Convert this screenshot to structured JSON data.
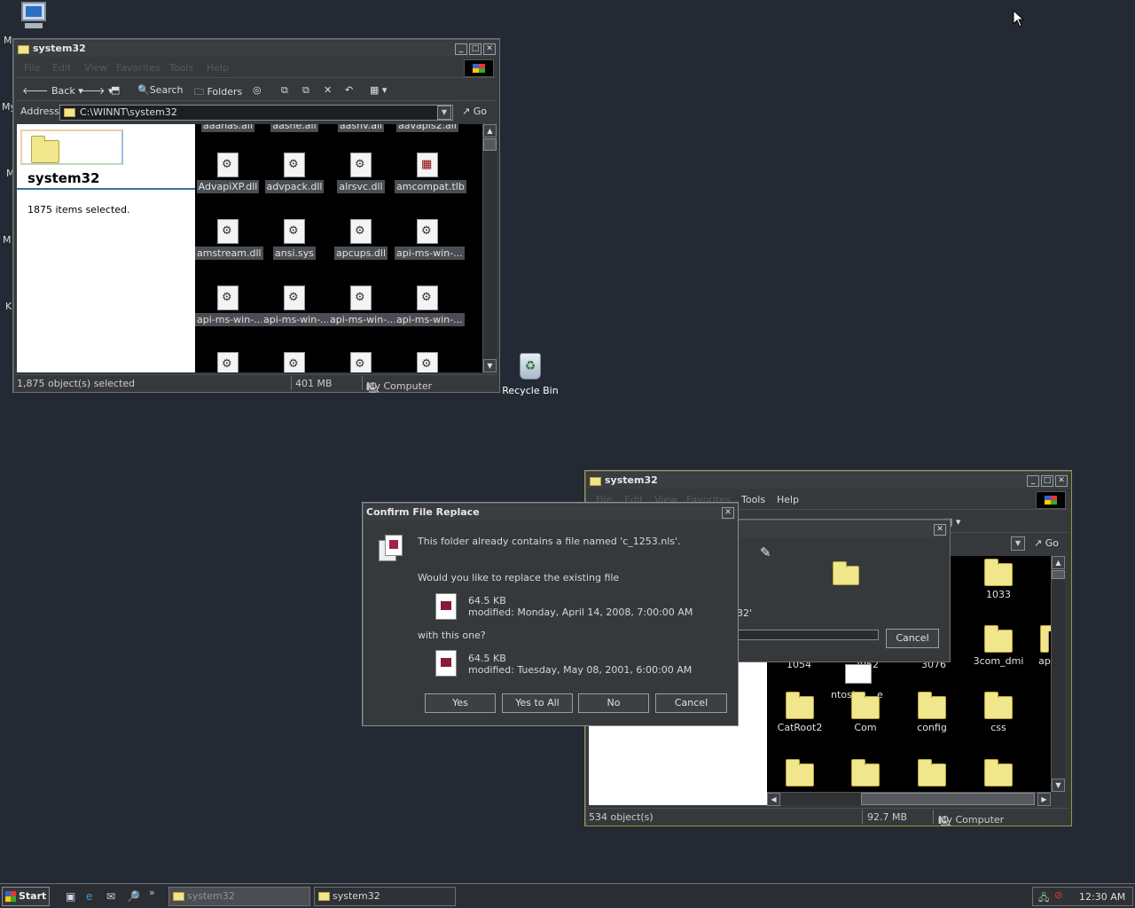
{
  "desktop": {
    "recycle_bin": "Recycle Bin",
    "left_letters": [
      "M",
      "My",
      "M",
      "M",
      "K"
    ]
  },
  "win1": {
    "title": "system32",
    "menu": [
      "File",
      "Edit",
      "View",
      "Favorites",
      "Tools",
      "Help"
    ],
    "toolbar": {
      "back": "Back",
      "search": "Search",
      "folders": "Folders"
    },
    "address_label": "Address",
    "address_value": "C:\\WINNT\\system32",
    "go": "Go",
    "pane_title": "system32",
    "pane_text": "1875 items selected.",
    "partial_row": [
      "aaanas.all",
      "aasne.all",
      "aasnv.all",
      "aavapis2.all"
    ],
    "files": [
      {
        "name": "AdvapiXP.dll",
        "icon": "dll-icon"
      },
      {
        "name": "advpack.dll",
        "icon": "dll-icon"
      },
      {
        "name": "alrsvc.dll",
        "icon": "dll-icon"
      },
      {
        "name": "amcompat.tlb",
        "icon": "tlb-icon"
      },
      {
        "name": "amstream.dll",
        "icon": "dll-icon"
      },
      {
        "name": "ansi.sys",
        "icon": "dll-icon"
      },
      {
        "name": "apcups.dll",
        "icon": "dll-icon"
      },
      {
        "name": "api-ms-win-...",
        "icon": "dll-icon"
      },
      {
        "name": "api-ms-win-...",
        "icon": "dll-icon"
      },
      {
        "name": "api-ms-win-...",
        "icon": "dll-icon"
      },
      {
        "name": "api-ms-win-...",
        "icon": "dll-icon"
      },
      {
        "name": "api-ms-win-...",
        "icon": "dll-icon"
      }
    ],
    "status": {
      "objects": "1,875 object(s) selected",
      "size": "401 MB",
      "zone": "My Computer"
    }
  },
  "win2": {
    "title": "system32",
    "menu": [
      "File",
      "Edit",
      "View",
      "Favorites",
      "Tools",
      "Help"
    ],
    "go": "Go",
    "folders_top": [
      "1033",
      "3com_dmi"
    ],
    "partial_labels": [
      "1054",
      "2052",
      "3076",
      "ap",
      "ntosk",
      "e"
    ],
    "folders": [
      "CatRoot2",
      "Com",
      "config",
      "css"
    ],
    "status": {
      "objects": "534 object(s)",
      "size": "92.7 MB",
      "zone": "My Computer"
    }
  },
  "copy_dialog": {
    "cancel": "Cancel",
    "partial_text": "32'"
  },
  "confirm": {
    "title": "Confirm File Replace",
    "line1": "This folder already contains a file named 'c_1253.nls'.",
    "line2": "Would you like to replace the existing file",
    "existing_size": "64.5 KB",
    "existing_modified": "modified: Monday, April 14, 2008, 7:00:00 AM",
    "line3": "with this one?",
    "new_size": "64.5 KB",
    "new_modified": "modified: Tuesday, May 08, 2001, 6:00:00 AM",
    "buttons": {
      "yes": "Yes",
      "yes_all": "Yes to All",
      "no": "No",
      "cancel": "Cancel"
    }
  },
  "taskbar": {
    "start": "Start",
    "tasks": [
      "system32",
      "system32"
    ],
    "clock": "12:30 AM"
  }
}
